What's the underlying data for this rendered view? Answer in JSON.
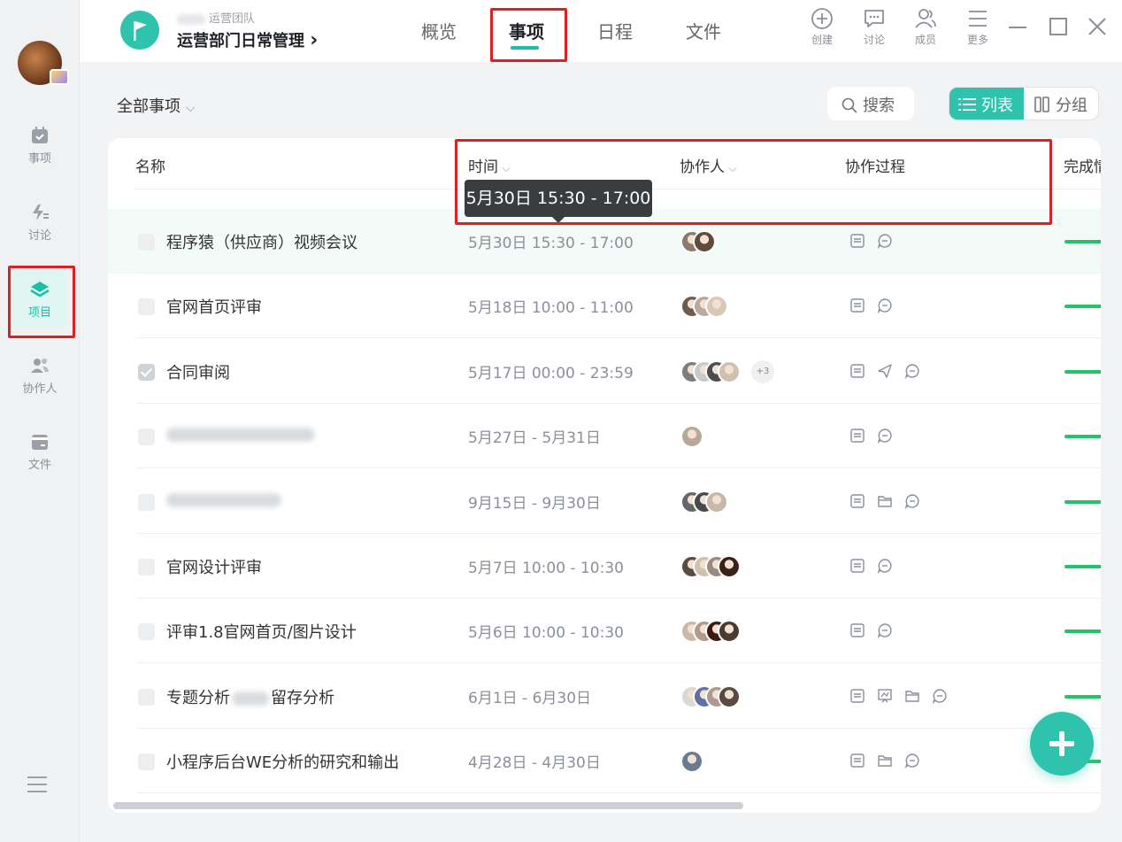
{
  "rail": {
    "items": [
      {
        "label": "事项",
        "icon": "calendar-check-icon"
      },
      {
        "label": "讨论",
        "icon": "discuss-icon"
      },
      {
        "label": "项目",
        "icon": "layers-icon",
        "active": true
      },
      {
        "label": "协作人",
        "icon": "people-icon"
      },
      {
        "label": "文件",
        "icon": "file-icon"
      }
    ]
  },
  "header": {
    "team": "运营团队",
    "project_name": "运营部门日常管理",
    "project_chevron": "›",
    "tabs": [
      {
        "label": "概览"
      },
      {
        "label": "事项",
        "active": true
      },
      {
        "label": "日程"
      },
      {
        "label": "文件"
      }
    ],
    "actions": [
      {
        "label": "创建",
        "icon": "plus-circle-icon"
      },
      {
        "label": "讨论",
        "icon": "chat-icon"
      },
      {
        "label": "成员",
        "icon": "members-icon"
      },
      {
        "label": "更多",
        "icon": "menu-icon"
      }
    ]
  },
  "toolbar": {
    "filter_label": "全部事项",
    "search_label": "搜索",
    "view_list_label": "列表",
    "view_group_label": "分组"
  },
  "table": {
    "columns": {
      "name": "名称",
      "time": "时间",
      "collaborators": "协作人",
      "process": "协作过程",
      "completion": "完成情"
    },
    "tooltip": "5月30日 15:30 - 17:00",
    "rows": [
      {
        "name": "程序猿（供应商）视频会议",
        "time": "5月30日 15:30 - 17:00",
        "done": false,
        "highlight": true,
        "avatars": [
          "#8c7a6e",
          "#5f4a3c"
        ],
        "more": "",
        "process": [
          "doc",
          "chat"
        ]
      },
      {
        "name": "官网首页评审",
        "time": "5月18日 10:00 - 11:00",
        "done": false,
        "avatars": [
          "#6d5b4f",
          "#b9aaa0",
          "#d8c8b8"
        ],
        "more": "",
        "process": [
          "doc",
          "chat"
        ]
      },
      {
        "name": "合同审阅",
        "time": "5月17日 00:00 - 23:59",
        "done": true,
        "avatars": [
          "#7d7d7d",
          "#c9c9c9",
          "#4d4d4d",
          "#cfc0b0"
        ],
        "more": "+3",
        "process": [
          "doc",
          "send",
          "chat"
        ]
      },
      {
        "name": "",
        "time": "5月27日 - 5月31日",
        "done": false,
        "blurred": true,
        "avatars": [
          "#b8a898"
        ],
        "more": "",
        "process": [
          "doc",
          "chat"
        ]
      },
      {
        "name": "",
        "time": "9月15日 - 9月30日",
        "done": false,
        "blurred": true,
        "avatars": [
          "#666666",
          "#4a4a4a",
          "#c8b8a8"
        ],
        "more": "",
        "process": [
          "doc",
          "folder",
          "chat"
        ]
      },
      {
        "name": "官网设计评审",
        "time": "5月7日 10:00 - 10:30",
        "done": false,
        "avatars": [
          "#5a4a40",
          "#d0c0b0",
          "#9a8a80",
          "#3a2218"
        ],
        "more": "",
        "process": [
          "doc",
          "chat"
        ]
      },
      {
        "name": "评审1.8官网首页/图片设计",
        "time": "5月6日 10:00 - 10:30",
        "done": false,
        "avatars": [
          "#c9b9a9",
          "#b09a8a",
          "#3a1a10",
          "#4a3a30"
        ],
        "more": "",
        "process": [
          "doc",
          "chat"
        ]
      },
      {
        "name": "专题分析 留存分析",
        "name_parts": [
          "专题分析",
          "留存分析"
        ],
        "time": "6月1日 - 6月30日",
        "done": false,
        "avatars": [
          "#d8d8d8",
          "#6070a0",
          "#aa9a90",
          "#5a4a40"
        ],
        "more": "",
        "process": [
          "doc",
          "board",
          "folder",
          "chat"
        ]
      },
      {
        "name": "小程序后台WE分析的研究和输出",
        "time": "4月28日 - 4月30日",
        "done": false,
        "avatars": [
          "#6a7a90"
        ],
        "more": "",
        "process": [
          "doc",
          "folder",
          "chat"
        ]
      }
    ]
  },
  "colors": {
    "accent": "#2fc3ad",
    "progress": "#22c46a",
    "annotation": "#e02020"
  }
}
